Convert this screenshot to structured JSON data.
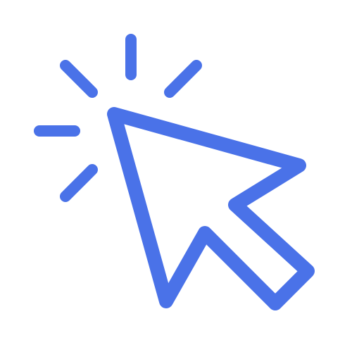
{
  "icon": {
    "name": "cursor-click-icon",
    "color": "#4a72e8",
    "background": "#ffffff"
  }
}
